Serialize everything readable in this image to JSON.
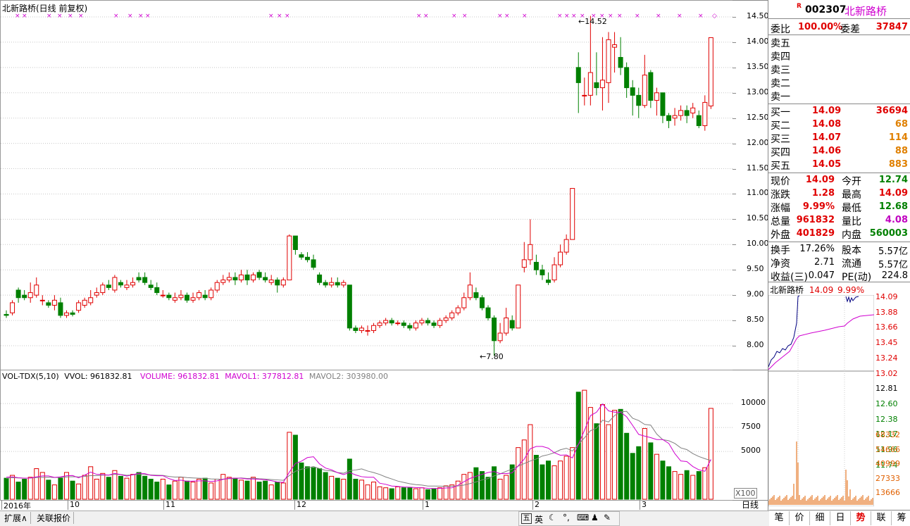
{
  "chart_title": "北新路桥(日线 前复权)",
  "price_axis": [
    "14.50",
    "14.00",
    "13.50",
    "13.00",
    "12.50",
    "12.00",
    "11.50",
    "11.00",
    "10.50",
    "10.00",
    "9.50",
    "9.00",
    "8.50",
    "8.00"
  ],
  "vol_axis": [
    "10000",
    "7500",
    "5000"
  ],
  "vol_unit": "X100",
  "price_annotations": {
    "high": "14.52",
    "low": "7.80"
  },
  "volume_legend": {
    "indicator": "VOL-TDX(5,10)",
    "vvol": "VVOL: 961832.81",
    "volume": "VOLUME: 961832.81",
    "mavol1": "MAVOL1: 377812.81",
    "mavol2": "MAVOL2: 303980.00"
  },
  "date_axis": [
    "2016年",
    "10",
    "11",
    "12",
    "1",
    "2",
    "3"
  ],
  "period_label": "日线",
  "bottom_tabs": [
    "扩展∧",
    "关联报价"
  ],
  "ime_bar": [
    "英"
  ],
  "quote": {
    "flag": "R",
    "code": "002307",
    "name": "北新路桥",
    "weibi_label": "委比",
    "weibi": "100.00%",
    "weicha_label": "委差",
    "weicha": "37847",
    "sell": [
      {
        "label": "卖五"
      },
      {
        "label": "卖四"
      },
      {
        "label": "卖三"
      },
      {
        "label": "卖二"
      },
      {
        "label": "卖一"
      }
    ],
    "buy": [
      {
        "label": "买一",
        "price": "14.09",
        "vol": "36694"
      },
      {
        "label": "买二",
        "price": "14.08",
        "vol": "68"
      },
      {
        "label": "买三",
        "price": "14.07",
        "vol": "114"
      },
      {
        "label": "买四",
        "price": "14.06",
        "vol": "88"
      },
      {
        "label": "买五",
        "price": "14.05",
        "vol": "883"
      }
    ],
    "stats": [
      {
        "l1": "现价",
        "v1": "14.09",
        "c1": "red",
        "l2": "今开",
        "v2": "12.74",
        "c2": "green"
      },
      {
        "l1": "涨跌",
        "v1": "1.28",
        "c1": "red",
        "l2": "最高",
        "v2": "14.09",
        "c2": "red"
      },
      {
        "l1": "涨幅",
        "v1": "9.99%",
        "c1": "red",
        "l2": "最低",
        "v2": "12.68",
        "c2": "green"
      },
      {
        "l1": "总量",
        "v1": "961832",
        "c1": "red",
        "l2": "量比",
        "v2": "4.08",
        "c2": "mag"
      },
      {
        "l1": "外盘",
        "v1": "401829",
        "c1": "red",
        "l2": "内盘",
        "v2": "560003",
        "c2": "green"
      }
    ],
    "stats2": [
      {
        "l1": "换手",
        "v1": "17.26%",
        "l2": "股本",
        "v2": "5.57亿"
      },
      {
        "l1": "净资",
        "v1": "2.71",
        "l2": "流通",
        "v2": "5.57亿"
      },
      {
        "l1": "收益(三)",
        "v1": "0.047",
        "l2": "PE(动)",
        "v2": "224.8"
      }
    ]
  },
  "mini": {
    "name": "北新路桥",
    "price": "14.09",
    "pct": "9.99%",
    "axis": [
      "14.09",
      "13.88",
      "13.66",
      "13.45",
      "13.24",
      "13.02",
      "12.81",
      "12.60",
      "12.38",
      "12.17",
      "11.96",
      "11.74"
    ],
    "vol_axis": [
      "68332",
      "54666",
      "40999",
      "27333",
      "13666"
    ]
  },
  "side_tabs": [
    "笔",
    "价",
    "细",
    "日",
    "势",
    "联",
    "筹"
  ],
  "colors": {
    "up": "#e00000",
    "down": "#008000",
    "ma1": "#d000d0",
    "ma2": "#808080",
    "grid": "#c8c8c8"
  },
  "chart_data": [
    {
      "type": "candlestick",
      "title": "北新路桥(日线 前复权)",
      "ylim": [
        7.6,
        14.7
      ],
      "candles": [
        [
          8.62,
          8.6,
          8.7,
          8.55
        ],
        [
          8.65,
          8.85,
          8.9,
          8.6
        ],
        [
          9.1,
          8.95,
          9.15,
          8.85
        ],
        [
          9.0,
          8.95,
          9.1,
          8.9
        ],
        [
          8.95,
          9.05,
          9.25,
          8.85
        ],
        [
          9.0,
          9.2,
          9.35,
          8.95
        ],
        [
          8.9,
          8.9,
          9.0,
          8.8
        ],
        [
          8.85,
          8.8,
          8.9,
          8.75
        ],
        [
          8.8,
          8.9,
          9.0,
          8.7
        ],
        [
          8.85,
          8.6,
          8.95,
          8.55
        ],
        [
          8.6,
          8.65,
          8.7,
          8.55
        ],
        [
          8.65,
          8.62,
          8.7,
          8.58
        ],
        [
          8.7,
          8.85,
          8.9,
          8.65
        ],
        [
          8.8,
          8.9,
          8.95,
          8.75
        ],
        [
          8.85,
          8.95,
          9.1,
          8.8
        ],
        [
          9.0,
          9.05,
          9.15,
          8.95
        ],
        [
          9.05,
          9.2,
          9.25,
          9.0
        ],
        [
          9.2,
          9.15,
          9.3,
          9.1
        ],
        [
          9.1,
          9.35,
          9.4,
          9.05
        ],
        [
          9.25,
          9.2,
          9.3,
          9.15
        ],
        [
          9.15,
          9.2,
          9.3,
          9.1
        ],
        [
          9.2,
          9.25,
          9.35,
          9.15
        ],
        [
          9.35,
          9.3,
          9.45,
          9.25
        ],
        [
          9.35,
          9.25,
          9.45,
          9.2
        ],
        [
          9.2,
          9.15,
          9.3,
          9.1
        ],
        [
          9.15,
          9.05,
          9.25,
          9.0
        ],
        [
          9.0,
          9.0,
          9.1,
          8.95
        ],
        [
          9.0,
          8.95,
          9.05,
          8.9
        ],
        [
          8.9,
          8.95,
          9.05,
          8.85
        ],
        [
          8.95,
          9.0,
          9.1,
          8.9
        ],
        [
          9.0,
          8.9,
          9.05,
          8.85
        ],
        [
          8.9,
          8.95,
          9.05,
          8.85
        ],
        [
          8.95,
          9.05,
          9.1,
          8.9
        ],
        [
          9.0,
          8.95,
          9.1,
          8.9
        ],
        [
          8.95,
          9.1,
          9.15,
          8.9
        ],
        [
          9.1,
          9.25,
          9.3,
          9.05
        ],
        [
          9.25,
          9.3,
          9.4,
          9.2
        ],
        [
          9.3,
          9.35,
          9.45,
          9.25
        ],
        [
          9.35,
          9.3,
          9.45,
          9.2
        ],
        [
          9.3,
          9.4,
          9.5,
          9.25
        ],
        [
          9.4,
          9.3,
          9.5,
          9.2
        ],
        [
          9.3,
          9.4,
          9.45,
          9.25
        ],
        [
          9.45,
          9.35,
          9.5,
          9.3
        ],
        [
          9.35,
          9.3,
          9.45,
          9.25
        ],
        [
          9.25,
          9.3,
          9.4,
          9.2
        ],
        [
          9.3,
          9.2,
          9.35,
          9.05
        ],
        [
          9.2,
          9.3,
          9.35,
          9.15
        ],
        [
          9.3,
          10.17,
          10.2,
          9.3
        ],
        [
          10.17,
          9.9,
          10.17,
          9.8
        ],
        [
          9.8,
          9.75,
          9.85,
          9.7
        ],
        [
          9.75,
          9.7,
          9.85,
          9.65
        ],
        [
          9.7,
          9.55,
          9.8,
          9.5
        ],
        [
          9.4,
          9.25,
          9.45,
          9.2
        ],
        [
          9.25,
          9.2,
          9.3,
          9.15
        ],
        [
          9.2,
          9.25,
          9.35,
          9.15
        ],
        [
          9.25,
          9.2,
          9.35,
          9.15
        ],
        [
          9.2,
          9.25,
          9.3,
          9.15
        ],
        [
          9.2,
          8.35,
          9.2,
          8.3
        ],
        [
          8.35,
          8.3,
          8.4,
          8.25
        ],
        [
          8.3,
          8.35,
          8.4,
          8.25
        ],
        [
          8.3,
          8.3,
          8.4,
          8.2
        ],
        [
          8.3,
          8.4,
          8.45,
          8.25
        ],
        [
          8.4,
          8.45,
          8.5,
          8.35
        ],
        [
          8.45,
          8.5,
          8.55,
          8.4
        ],
        [
          8.5,
          8.45,
          8.55,
          8.4
        ],
        [
          8.45,
          8.45,
          8.5,
          8.4
        ],
        [
          8.45,
          8.4,
          8.5,
          8.35
        ],
        [
          8.4,
          8.35,
          8.45,
          8.3
        ],
        [
          8.35,
          8.45,
          8.5,
          8.3
        ],
        [
          8.45,
          8.5,
          8.55,
          8.4
        ],
        [
          8.5,
          8.45,
          8.55,
          8.4
        ],
        [
          8.45,
          8.4,
          8.5,
          8.35
        ],
        [
          8.4,
          8.5,
          8.55,
          8.35
        ],
        [
          8.5,
          8.55,
          8.6,
          8.45
        ],
        [
          8.55,
          8.65,
          8.7,
          8.5
        ],
        [
          8.65,
          8.75,
          8.8,
          8.6
        ],
        [
          8.75,
          8.95,
          9.05,
          8.7
        ],
        [
          8.95,
          9.2,
          9.45,
          8.9
        ],
        [
          9.05,
          8.95,
          9.15,
          8.9
        ],
        [
          8.95,
          8.75,
          9.0,
          8.7
        ],
        [
          8.75,
          8.55,
          8.8,
          8.5
        ],
        [
          8.55,
          8.1,
          8.6,
          7.8
        ],
        [
          8.1,
          8.25,
          8.45,
          8.05
        ],
        [
          8.25,
          8.55,
          8.75,
          8.2
        ],
        [
          8.5,
          8.35,
          8.6,
          8.3
        ],
        [
          8.35,
          9.2,
          9.2,
          8.35
        ],
        [
          9.55,
          9.7,
          10.05,
          9.45
        ],
        [
          9.7,
          10.0,
          10.5,
          9.6
        ],
        [
          9.65,
          9.5,
          9.8,
          9.4
        ],
        [
          9.5,
          9.4,
          9.6,
          9.3
        ],
        [
          9.3,
          9.25,
          9.45,
          9.2
        ],
        [
          9.3,
          9.6,
          9.75,
          9.25
        ],
        [
          9.6,
          9.85,
          10.0,
          9.55
        ],
        [
          9.85,
          10.1,
          10.2,
          9.8
        ],
        [
          10.1,
          11.11,
          11.11,
          10.1
        ],
        [
          13.5,
          13.2,
          13.8,
          12.6
        ],
        [
          12.95,
          12.95,
          13.3,
          12.75
        ],
        [
          12.95,
          13.4,
          14.52,
          12.75
        ],
        [
          13.2,
          13.1,
          13.8,
          12.95
        ],
        [
          13.1,
          13.25,
          14.1,
          12.65
        ],
        [
          13.2,
          14.05,
          14.2,
          12.8
        ],
        [
          13.9,
          13.95,
          14.2,
          13.4
        ],
        [
          13.7,
          13.5,
          14.1,
          13.35
        ],
        [
          13.5,
          13.1,
          13.6,
          12.9
        ],
        [
          13.1,
          12.95,
          13.25,
          12.55
        ],
        [
          12.95,
          12.75,
          13.1,
          12.5
        ],
        [
          12.75,
          13.35,
          13.75,
          12.7
        ],
        [
          13.4,
          12.85,
          13.45,
          12.7
        ],
        [
          12.85,
          13.0,
          13.1,
          12.55
        ],
        [
          13.0,
          12.55,
          13.0,
          12.4
        ],
        [
          12.55,
          12.45,
          12.6,
          12.3
        ],
        [
          12.5,
          12.55,
          12.7,
          12.35
        ],
        [
          12.55,
          12.65,
          12.75,
          12.45
        ],
        [
          12.65,
          12.55,
          12.75,
          12.4
        ],
        [
          12.6,
          12.7,
          12.8,
          12.5
        ],
        [
          12.55,
          12.35,
          12.65,
          12.3
        ],
        [
          12.35,
          12.81,
          12.95,
          12.25
        ],
        [
          12.74,
          14.09,
          14.09,
          12.68
        ]
      ]
    },
    {
      "type": "bar",
      "title": "VOL-TDX(5,10)",
      "ylim": [
        0,
        12000
      ],
      "values": [
        2200,
        2500,
        1800,
        2100,
        2300,
        3200,
        2800,
        2000,
        1500,
        2200,
        2800,
        1900,
        1600,
        2500,
        3400,
        2100,
        2700,
        2300,
        3000,
        2400,
        2200,
        2600,
        2800,
        2400,
        2100,
        1800,
        2100,
        1500,
        1900,
        2300,
        1900,
        1800,
        2100,
        2200,
        1700,
        2100,
        2600,
        2300,
        2200,
        2000,
        1900,
        2300,
        1800,
        1900,
        1500,
        1800,
        1700,
        7000,
        6700,
        3800,
        3400,
        3300,
        3200,
        2800,
        2400,
        2200,
        2100,
        4200,
        2100,
        2000,
        1500,
        1800,
        1300,
        1200,
        1100,
        1300,
        1200,
        1200,
        1100,
        1200,
        1000,
        1100,
        1200,
        1400,
        1500,
        1900,
        2600,
        2800,
        3300,
        2900,
        2300,
        3400,
        2100,
        2500,
        3600,
        5400,
        6200,
        7800,
        4600,
        3600,
        4000,
        3500,
        4000,
        4500,
        5400,
        11200,
        11400,
        9600,
        7900,
        9900,
        7800,
        9300,
        9400,
        6900,
        4800,
        5500,
        7400,
        5900,
        4700,
        4000,
        3400,
        2900,
        2600,
        3000,
        2500,
        2900,
        3300,
        9500
      ],
      "mavol1": [
        2300,
        2350,
        2250,
        2200,
        2220,
        2340,
        2440,
        2440,
        2280,
        2340,
        2460,
        2480,
        2240,
        2520,
        2840,
        2600,
        2580,
        2520,
        2700,
        2580,
        2420,
        2560,
        2720,
        2680,
        2500,
        2460,
        2460,
        2160,
        1960,
        2000,
        1880,
        1900,
        1920,
        1920,
        1860,
        1920,
        2080,
        2200,
        2200,
        2200,
        2120,
        2120,
        2080,
        2040,
        1940,
        1800,
        1760,
        2840,
        3740,
        3980,
        4360,
        4440,
        3700,
        3260,
        3080,
        2780,
        2580,
        2800,
        2540,
        2360,
        2300,
        2300,
        1680,
        1560,
        1380,
        1340,
        1280,
        1260,
        1220,
        1200,
        1140,
        1120,
        1140,
        1180,
        1200,
        1460,
        1840,
        2180,
        2400,
        2600,
        2800,
        2900,
        2680,
        2680,
        2760,
        3500,
        4200,
        5280,
        5520,
        5520,
        5340,
        4860,
        4600,
        4640,
        4320,
        5740,
        7200,
        8740,
        9100,
        9960,
        9240,
        9100,
        9100,
        8620,
        7720,
        6780,
        6600,
        6440,
        6240,
        6240,
        5840,
        4780,
        4000,
        3940,
        3420,
        3080,
        2920,
        4160
      ],
      "mavol2": [
        2200,
        2250,
        2230,
        2210,
        2220,
        2260,
        2290,
        2300,
        2270,
        2280,
        2330,
        2360,
        2340,
        2380,
        2470,
        2470,
        2520,
        2520,
        2600,
        2590,
        2500,
        2550,
        2600,
        2580,
        2540,
        2510,
        2490,
        2380,
        2320,
        2330,
        2260,
        2230,
        2200,
        2180,
        2130,
        2100,
        2110,
        2140,
        2180,
        2230,
        2170,
        2200,
        2140,
        2110,
        2060,
        2020,
        1980,
        2480,
        2920,
        3140,
        3280,
        3420,
        3200,
        3020,
        2960,
        2790,
        2720,
        2990,
        3060,
        3170,
        2950,
        2790,
        2590,
        2330,
        2120,
        1900,
        1760,
        1620,
        1530,
        1480,
        1380,
        1380,
        1370,
        1350,
        1360,
        1390,
        1480,
        1640,
        1810,
        2020,
        2160,
        2440,
        2650,
        2920,
        3150,
        3460,
        3730,
        4000,
        4210,
        4520,
        4660,
        4870,
        5170,
        5330,
        5040,
        5750,
        6420,
        7170,
        7420,
        8270,
        8080,
        8750,
        9140,
        9190,
        8470,
        8230,
        7820,
        7750,
        6820,
        6230,
        6120,
        5840,
        5370,
        5190,
        4770,
        4470,
        4240,
        4040
      ]
    }
  ]
}
